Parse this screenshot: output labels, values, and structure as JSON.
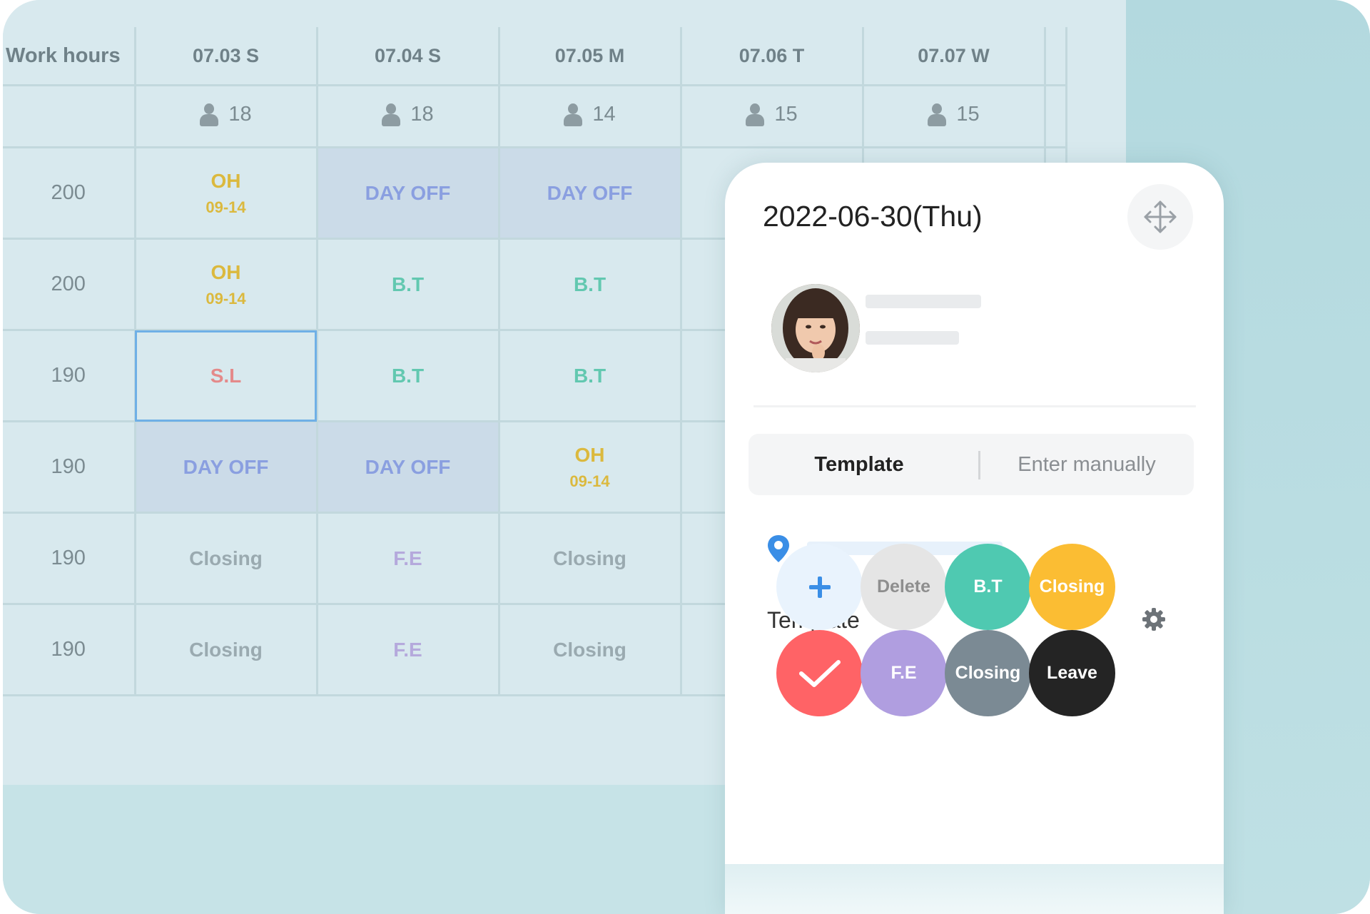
{
  "schedule": {
    "header": {
      "label": "Work hours",
      "days": [
        "07.03 S",
        "07.04 S",
        "07.05 M",
        "07.06 T",
        "07.07 W"
      ]
    },
    "counts": [
      "18",
      "18",
      "14",
      "15",
      "15"
    ],
    "rows": [
      {
        "hours": "200",
        "cells": [
          {
            "type": "oh",
            "label": "OH",
            "time": "09-14"
          },
          {
            "type": "dayoff",
            "label": "DAY OFF"
          },
          {
            "type": "dayoff",
            "label": "DAY OFF"
          },
          {
            "type": "empty"
          },
          {
            "type": "empty"
          }
        ]
      },
      {
        "hours": "200",
        "cells": [
          {
            "type": "oh",
            "label": "OH",
            "time": "09-14"
          },
          {
            "type": "bt",
            "label": "B.T"
          },
          {
            "type": "bt",
            "label": "B.T"
          },
          {
            "type": "empty"
          },
          {
            "type": "empty"
          }
        ]
      },
      {
        "hours": "190",
        "cells": [
          {
            "type": "sl",
            "label": "S.L",
            "selected": true
          },
          {
            "type": "bt",
            "label": "B.T"
          },
          {
            "type": "bt",
            "label": "B.T"
          },
          {
            "type": "empty"
          },
          {
            "type": "empty"
          }
        ]
      },
      {
        "hours": "190",
        "cells": [
          {
            "type": "dayoff",
            "label": "DAY OFF"
          },
          {
            "type": "dayoff",
            "label": "DAY OFF"
          },
          {
            "type": "oh",
            "label": "OH",
            "time": "09-14"
          },
          {
            "type": "empty"
          },
          {
            "type": "empty"
          }
        ]
      },
      {
        "hours": "190",
        "cells": [
          {
            "type": "closing",
            "label": "Closing"
          },
          {
            "type": "fe",
            "label": "F.E"
          },
          {
            "type": "closing",
            "label": "Closing"
          },
          {
            "type": "empty"
          },
          {
            "type": "empty"
          }
        ]
      },
      {
        "hours": "190",
        "cells": [
          {
            "type": "closing",
            "label": "Closing"
          },
          {
            "type": "fe",
            "label": "F.E"
          },
          {
            "type": "closing",
            "label": "Closing"
          },
          {
            "type": "empty"
          },
          {
            "type": "empty"
          }
        ]
      }
    ]
  },
  "panel": {
    "date": "2022-06-30(Thu)",
    "tabs": {
      "active": "Template",
      "inactive": "Enter manually"
    },
    "template_label": "Template",
    "buttons": [
      {
        "label": "",
        "icon": "plus-icon",
        "bg": "#e9f3fd",
        "color": "#3a8ee6"
      },
      {
        "label": "Delete",
        "bg": "#e5e5e5",
        "color": "#8e8e8e"
      },
      {
        "label": "B.T",
        "bg": "#4fc9b1",
        "color": "#ffffff"
      },
      {
        "label": "Closing",
        "bg": "#fbbd33",
        "color": "#ffffff"
      },
      {
        "label": "",
        "icon": "check-icon",
        "bg": "#ff6366",
        "color": "#ffffff"
      },
      {
        "label": "F.E",
        "bg": "#b09ee0",
        "color": "#ffffff"
      },
      {
        "label": "Closing",
        "bg": "#7b8a94",
        "color": "#ffffff"
      },
      {
        "label": "Leave",
        "bg": "#242424",
        "color": "#ffffff"
      }
    ]
  },
  "colors": {
    "accent_blue": "#3a8ee6",
    "selected_outline": "#6fb0e6",
    "oh": "#dbb93e",
    "dayoff": "#8a9fe0",
    "bt": "#62c8b0",
    "sl": "#e48a8a",
    "fe": "#b5a9dc"
  }
}
